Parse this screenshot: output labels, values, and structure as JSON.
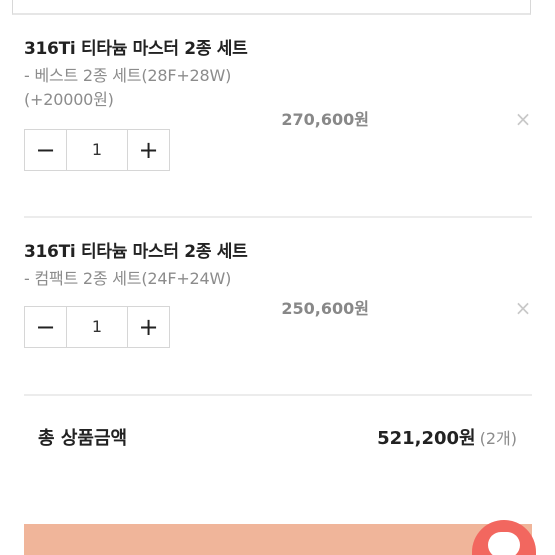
{
  "cart": {
    "items": [
      {
        "title": "316Ti 티타늄 마스터 2종 세트",
        "option_line1": "- 베스트 2종 세트(28F+28W)",
        "option_line2": "(+20000원)",
        "price": "270,600원",
        "quantity": "1",
        "minus_label": "−",
        "plus_label": "+",
        "remove_label": "×"
      },
      {
        "title": "316Ti 티타늄 마스터 2종 세트",
        "option_line1": "- 컴팩트 2종 세트(24F+24W)",
        "price": "250,600원",
        "quantity": "1",
        "minus_label": "−",
        "plus_label": "+",
        "remove_label": "×"
      }
    ],
    "total": {
      "label": "총 상품금액",
      "amount": "521,200원",
      "count": "(2개)"
    }
  },
  "colors": {
    "bottom_bar": "#f0b59a",
    "chat_button": "#f2675f"
  },
  "icons": {
    "chat": "chat-bubble-icon"
  }
}
